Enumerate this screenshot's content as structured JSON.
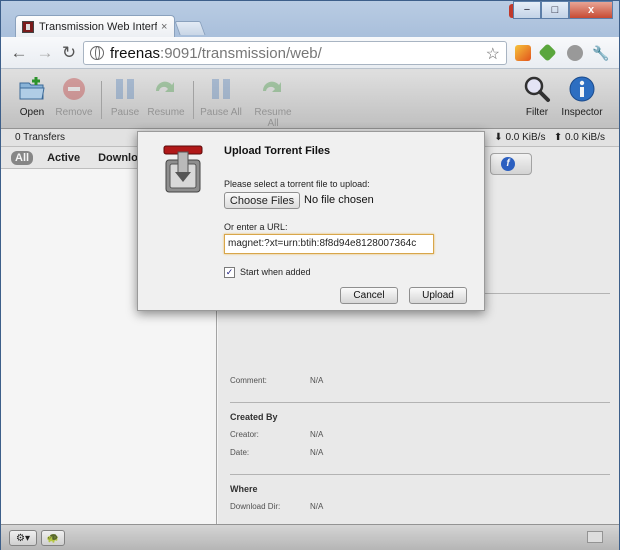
{
  "browser": {
    "tab_title": "Transmission Web Interfac",
    "tab_close": "×",
    "url_host": "freenas",
    "url_rest": ":9091/transmission/web/",
    "window_buttons": {
      "minimize": "−",
      "maximize": "□",
      "close": "x"
    },
    "nav": {
      "back": "←",
      "forward": "→",
      "reload": "↻",
      "bookmark": "☆",
      "wrench": "🔧"
    }
  },
  "toolbar": {
    "open": "Open",
    "remove": "Remove",
    "pause": "Pause",
    "resume": "Resume",
    "pause_all": "Pause All",
    "resume_all": "Resume All",
    "filter": "Filter",
    "inspector": "Inspector"
  },
  "status": {
    "transfers": "0 Transfers",
    "down_speed": "⬇ 0.0 KiB/s",
    "up_speed": "⬆ 0.0 KiB/s"
  },
  "filters": [
    "All",
    "Active",
    "Downlo"
  ],
  "inspector": {
    "info_icon": "f",
    "comment_label": "Comment:",
    "comment_value": "N/A",
    "created_by_heading": "Created By",
    "creator_label": "Creator:",
    "creator_value": "N/A",
    "date_label": "Date:",
    "date_value": "N/A",
    "where_heading": "Where",
    "download_dir_label": "Download Dir:",
    "download_dir_value": "N/A"
  },
  "footer": {
    "gear": "⚙▾",
    "turtle": "🐢"
  },
  "dialog": {
    "title": "Upload Torrent Files",
    "file_prompt": "Please select a torrent file to upload:",
    "choose_button": "Choose Files",
    "no_file": "No file chosen",
    "url_label": "Or enter a URL:",
    "url_value": "magnet:?xt=urn:btih:8f8d94e8128007364c",
    "start_checked": true,
    "start_label": "Start when added",
    "cancel": "Cancel",
    "upload": "Upload"
  }
}
